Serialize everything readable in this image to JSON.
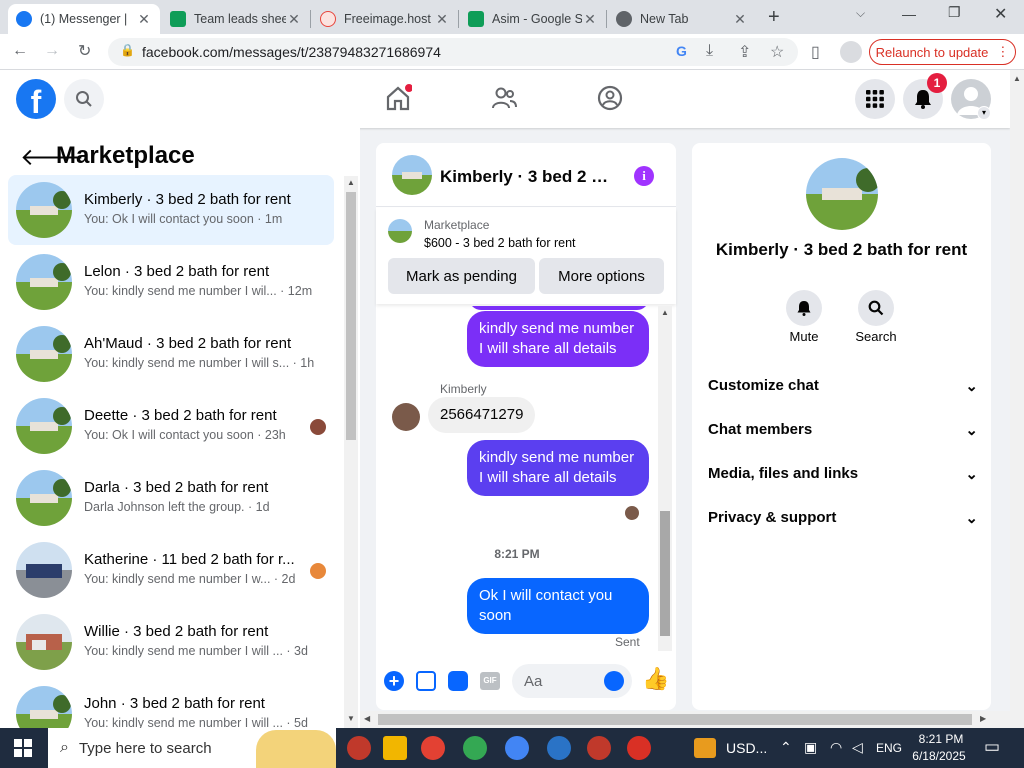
{
  "browser": {
    "tabs": [
      {
        "title": "(1) Messenger |",
        "icon": "facebook-icon",
        "color": "#1877f2"
      },
      {
        "title": "Team leads shee",
        "icon": "sheets-icon",
        "color": "#0f9d58"
      },
      {
        "title": "Freeimage.host",
        "icon": "freeimage-icon",
        "color": "#e8453c"
      },
      {
        "title": "Asim - Google S",
        "icon": "sheets-icon",
        "color": "#0f9d58"
      },
      {
        "title": "New Tab",
        "icon": "chrome-icon",
        "color": "#5f6368"
      }
    ],
    "new_tab": "+",
    "url": "facebook.com/messages/t/23879483271686974",
    "relaunch": "Relaunch to update"
  },
  "header": {
    "logo": "f",
    "notification_count": "1"
  },
  "sidebar": {
    "title": "Marketplace",
    "conversations": [
      {
        "name": "Kimberly · 3 bed 2 bath for rent",
        "preview": "You: Ok I will contact you soon · 1m",
        "selected": true
      },
      {
        "name": "Lelon · 3 bed 2 bath for rent",
        "preview": "You: kindly send me number I wil... · 12m"
      },
      {
        "name": "Ah'Maud · 3 bed 2 bath for rent",
        "preview": "You: kindly send me number I will s... · 1h"
      },
      {
        "name": "Deette · 3 bed 2 bath for rent",
        "preview": "You: Ok I will contact you soon · 23h",
        "read": true
      },
      {
        "name": "Darla · 3 bed 2 bath for rent",
        "preview": "Darla Johnson left the group. · 1d"
      },
      {
        "name": "Katherine · 11 bed 2 bath for r...",
        "preview": "You: kindly send me number I w... · 2d",
        "read": true
      },
      {
        "name": "Willie · 3 bed 2 bath for rent",
        "preview": "You: kindly send me number I will ... · 3d"
      },
      {
        "name": "John · 3 bed 2 bath for rent",
        "preview": "You: kindly send me number I will ... · 5d"
      }
    ]
  },
  "chat": {
    "title": "Kimberly · 3 bed 2 b...",
    "listing_label": "Marketplace",
    "listing_title": "$600 - 3 bed 2 bath for rent",
    "mark_pending": "Mark as pending",
    "more_options": "More options",
    "messages": [
      {
        "text": "kindly send me number I will share all details",
        "from": "me"
      },
      {
        "sender": "Kimberly",
        "text": "2566471279",
        "from": "them"
      },
      {
        "text": "kindly send me number I will share all details",
        "from": "me"
      },
      {
        "time": "8:21 PM"
      },
      {
        "text": "Ok I will contact you soon",
        "from": "me",
        "status": "Sent"
      }
    ],
    "composer_placeholder": "Aa",
    "gif": "GIF"
  },
  "info": {
    "name": "Kimberly · 3 bed 2 bath for rent",
    "mute": "Mute",
    "search": "Search",
    "sections": [
      "Customize chat",
      "Chat members",
      "Media, files and links",
      "Privacy & support"
    ]
  },
  "taskbar": {
    "search_placeholder": "Type here to search",
    "currency": "USD...",
    "lang": "ENG",
    "time": "8:21 PM",
    "date": "6/18/2025"
  }
}
